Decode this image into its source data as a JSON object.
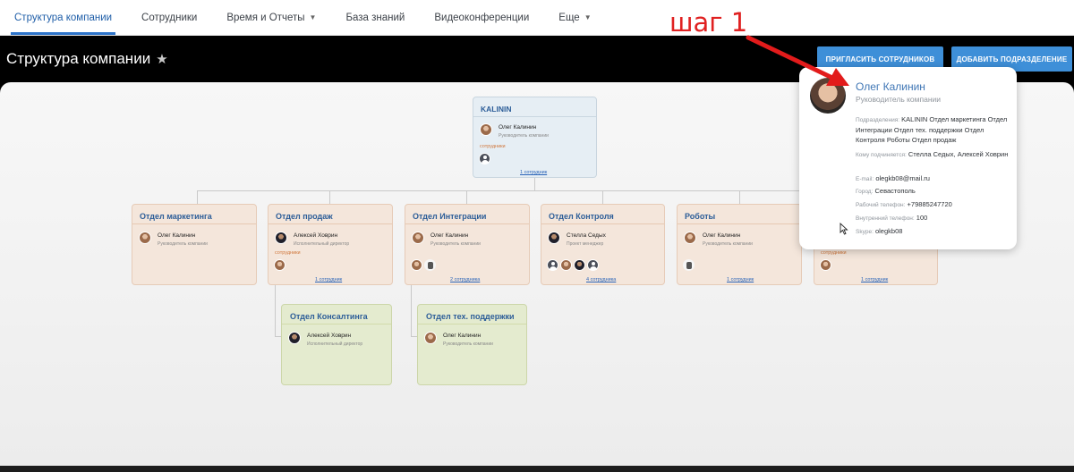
{
  "nav": {
    "tabs": [
      {
        "label": "Структура компании",
        "active": true
      },
      {
        "label": "Сотрудники"
      },
      {
        "label": "Время и Отчеты",
        "dropdown": true
      },
      {
        "label": "База знаний"
      },
      {
        "label": "Видеоконференции"
      },
      {
        "label": "Еще",
        "dropdown": true
      }
    ]
  },
  "header": {
    "title": "Структура компании",
    "invite_button": "ПРИГЛАСИТЬ СОТРУДНИКОВ",
    "add_button": "ДОБАВИТЬ ПОДРАЗДЕЛЕНИЕ"
  },
  "annotation": {
    "step": "шаг 1"
  },
  "root_card": {
    "title": "KALININ",
    "person": {
      "name": "Олег Калинин",
      "role": "Руководитель компании"
    },
    "staff_label": "сотрудники",
    "link": "1 сотрудник"
  },
  "departments": [
    {
      "title": "Отдел маркетинга",
      "person": {
        "name": "Олег Калинин",
        "role": "Руководитель компании"
      }
    },
    {
      "title": "Отдел продаж",
      "person": {
        "name": "Алексей Ховрин",
        "role": "Исполнительный директор"
      },
      "staff_label": "сотрудники",
      "link": "1 сотрудник"
    },
    {
      "title": "Отдел Интеграции",
      "person": {
        "name": "Олег Калинин",
        "role": "Руководитель компании"
      },
      "link": "2 сотрудника"
    },
    {
      "title": "Отдел Контроля",
      "person": {
        "name": "Стелла Седых",
        "role": "Проект менеджер"
      },
      "link": "4 сотрудника"
    },
    {
      "title": "Роботы",
      "person": {
        "name": "Олег Калинин",
        "role": "Руководитель компании"
      },
      "link": "1 сотрудник"
    },
    {
      "title": "",
      "staff_label": "сотрудники",
      "link": "1 сотрудник"
    }
  ],
  "sub_departments": [
    {
      "title": "Отдел Консалтинга",
      "person": {
        "name": "Алексей Ховрин",
        "role": "Исполнительный директор"
      }
    },
    {
      "title": "Отдел тех. поддержки",
      "person": {
        "name": "Олег Калинин",
        "role": "Руководитель компании"
      }
    }
  ],
  "popup": {
    "name": "Олег Калинин",
    "role": "Руководитель компании",
    "departments_label": "Подразделения:",
    "departments": "KALININ Отдел маркетинга Отдел Интеграции Отдел тех. поддержки Отдел Контроля Роботы Отдел продаж",
    "reports_label": "Кому подчиняется:",
    "reports": "Стелла Седых, Алексей Ховрин",
    "email_label": "E-mail:",
    "email": "olegkb08@mail.ru",
    "city_label": "Город:",
    "city": "Севастополь",
    "work_phone_label": "Рабочий телефон:",
    "work_phone": "+79885247720",
    "internal_phone_label": "Внутренний телефон:",
    "internal_phone": "100",
    "skype_label": "Skype:",
    "skype": "olegkb08"
  }
}
